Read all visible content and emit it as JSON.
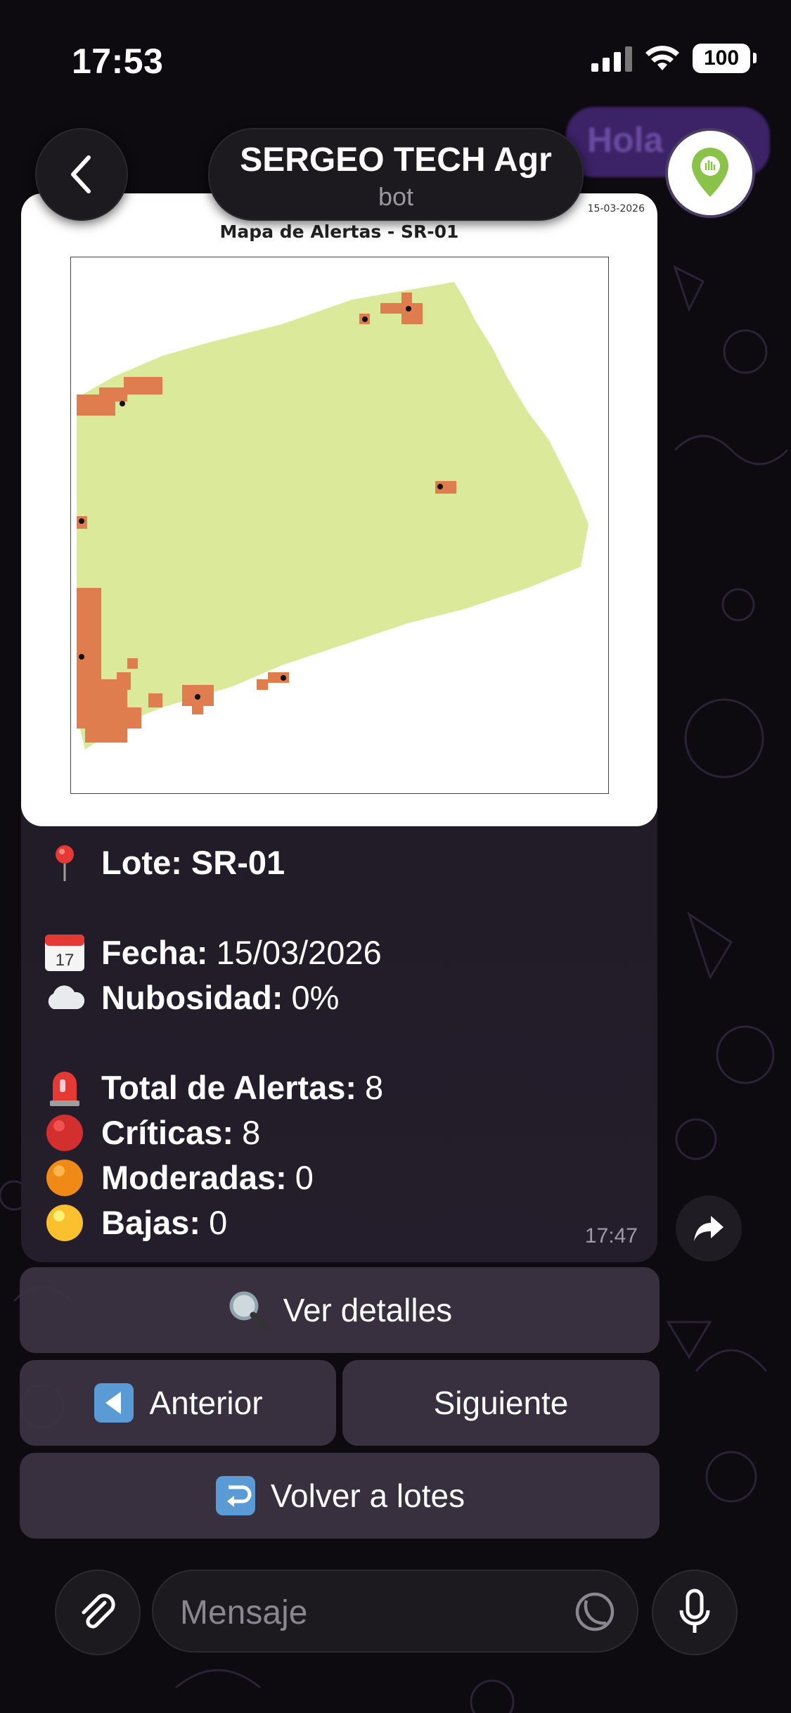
{
  "status_bar": {
    "time": "17:53",
    "battery": "100"
  },
  "header": {
    "title": "SERGEO TECH Agr",
    "subtitle": "bot"
  },
  "background_bubble": {
    "text": "Hola"
  },
  "message": {
    "map": {
      "title": "Mapa de Alertas - SR-01",
      "date": "15-03-2026",
      "field_color": "#dbe99a",
      "alert_color": "#e07d4f"
    },
    "lote": {
      "label": "Lote: SR-01"
    },
    "fecha": {
      "label": "Fecha:",
      "value": "15/03/2026"
    },
    "nubosidad": {
      "label": "Nubosidad:",
      "value": "0%"
    },
    "total": {
      "label": "Total de Alertas:",
      "value": "8"
    },
    "criticas": {
      "label": "Críticas:",
      "value": "8"
    },
    "moderadas": {
      "label": "Moderadas:",
      "value": "0"
    },
    "bajas": {
      "label": "Bajas:",
      "value": "0"
    },
    "time": "17:47",
    "icons": [
      "pin-icon",
      "calendar-icon",
      "cloud-icon",
      "siren-icon",
      "red-circle-icon",
      "orange-circle-icon",
      "yellow-circle-icon"
    ]
  },
  "keyboard": {
    "details": "Ver detalles",
    "previous": "Anterior",
    "next": "Siguiente",
    "back": "Volver a lotes"
  },
  "composer": {
    "placeholder": "Mensaje"
  },
  "colors": {
    "accent_green": "#8bc34a",
    "bubble_bg": "#2b2430"
  }
}
